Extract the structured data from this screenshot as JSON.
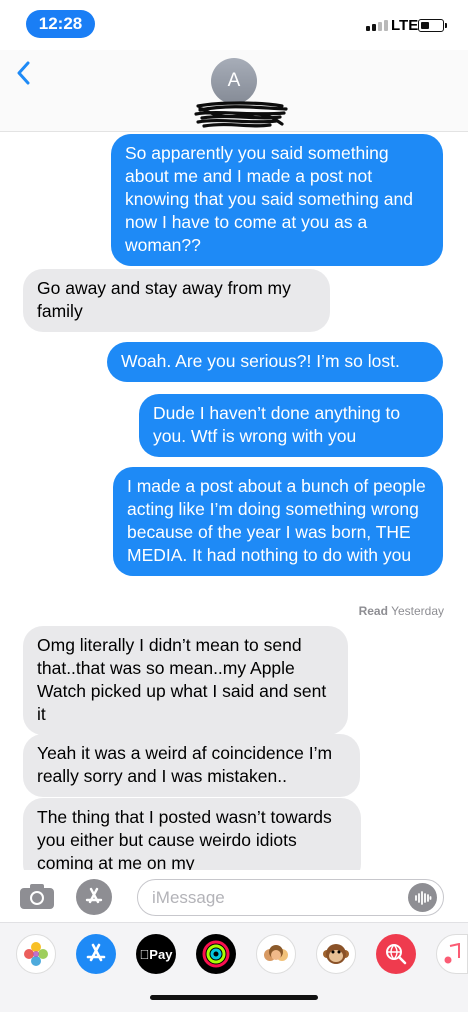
{
  "status_bar": {
    "time": "12:28",
    "network": "LTE",
    "signal_bars": 2,
    "signal_total": 4,
    "battery_level": 0.3
  },
  "header": {
    "back_icon": "chevron-left-icon",
    "avatar_initial": "A"
  },
  "colors": {
    "accent": "#1e8af6",
    "outgoing_bubble": "#1e8af6",
    "incoming_bubble": "#e9e9eb"
  },
  "messages": [
    {
      "direction": "outgoing",
      "text": "So apparently you said something about me and I made a post not knowing that you said something and now I have to come at you as a woman??"
    },
    {
      "direction": "incoming",
      "text": "Go away and stay away from my family"
    },
    {
      "direction": "outgoing",
      "text": "Woah. Are you serious?! I’m so lost."
    },
    {
      "direction": "outgoing",
      "text": "Dude I haven’t done anything to you. Wtf is wrong with you"
    },
    {
      "direction": "outgoing",
      "text": "I made a post about a bunch of people acting like I’m doing something wrong because of the year I was born, THE MEDIA. It had nothing to do with you"
    },
    {
      "direction": "incoming",
      "text": "Omg literally I didn’t mean to send that..that was so mean..my Apple Watch picked up what I said and sent it"
    },
    {
      "direction": "incoming",
      "text": "Yeah it was a weird af coincidence I’m really sorry and I was mistaken.."
    },
    {
      "direction": "incoming",
      "text": "The thing that I posted wasn’t towards you either but cause weirdo idiots coming at me on my"
    }
  ],
  "receipt": {
    "label": "Read",
    "time": "Yesterday"
  },
  "input": {
    "placeholder": "iMessage"
  },
  "apps": {
    "apple_pay_label": "Pay"
  }
}
